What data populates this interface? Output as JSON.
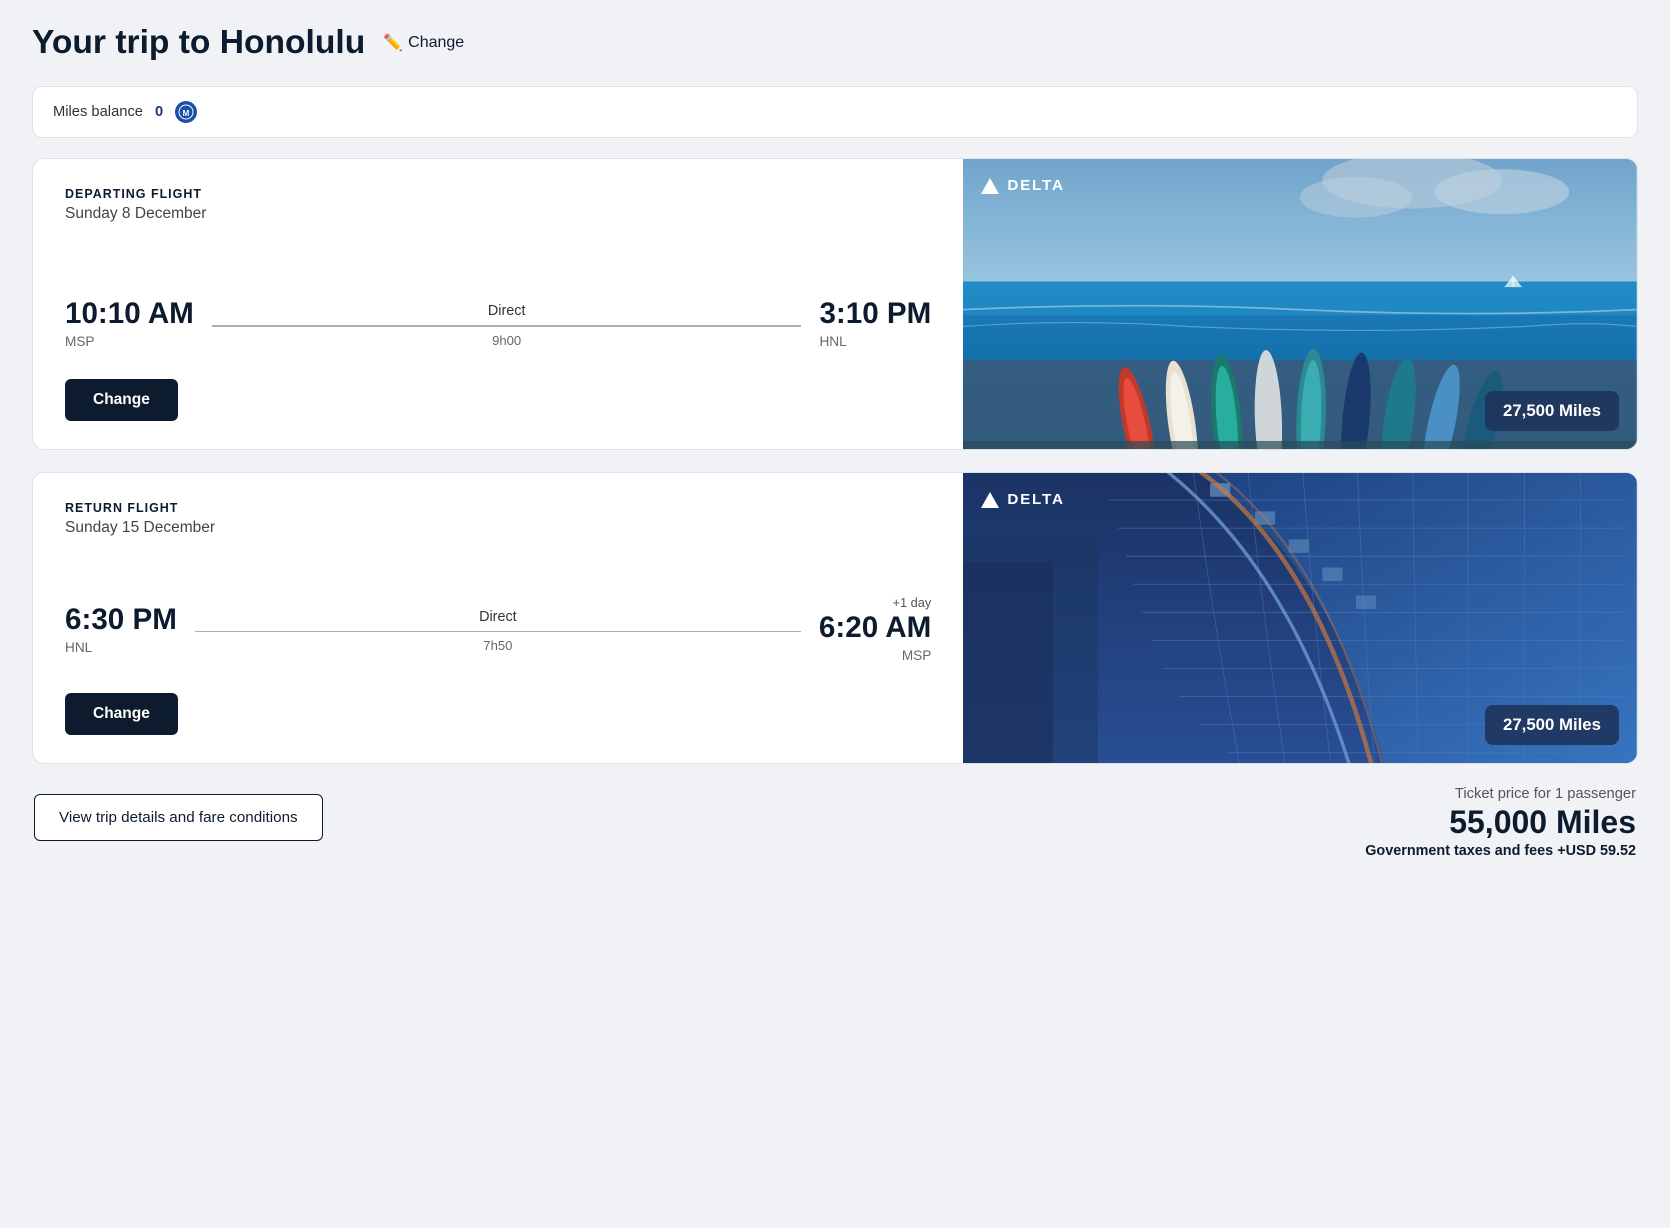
{
  "page": {
    "title": "Your trip to Honolulu",
    "change_label": "Change",
    "background_color": "#f0f2f5"
  },
  "miles_balance": {
    "label": "Miles balance",
    "value": "0"
  },
  "departing_flight": {
    "type_label": "DEPARTING FLIGHT",
    "date": "Sunday 8 December",
    "depart_time": "10:10 AM",
    "depart_airport": "MSP",
    "arrive_time": "3:10 PM",
    "arrive_airport": "HNL",
    "direct_label": "Direct",
    "duration": "9h00",
    "plus_day": "",
    "change_button": "Change",
    "airline": "DELTA",
    "miles": "27,500 Miles"
  },
  "return_flight": {
    "type_label": "RETURN FLIGHT",
    "date": "Sunday 15 December",
    "depart_time": "6:30 PM",
    "depart_airport": "HNL",
    "arrive_time": "6:20 AM",
    "arrive_airport": "MSP",
    "direct_label": "Direct",
    "duration": "7h50",
    "plus_day": "+1 day",
    "change_button": "Change",
    "airline": "DELTA",
    "miles": "27,500 Miles"
  },
  "summary": {
    "ticket_price_label": "Ticket price for 1 passenger",
    "total_miles": "55,000 Miles",
    "taxes_label": "Government taxes and fees",
    "taxes_value": "+USD 59.52",
    "view_trip_button": "View trip details and fare conditions"
  }
}
